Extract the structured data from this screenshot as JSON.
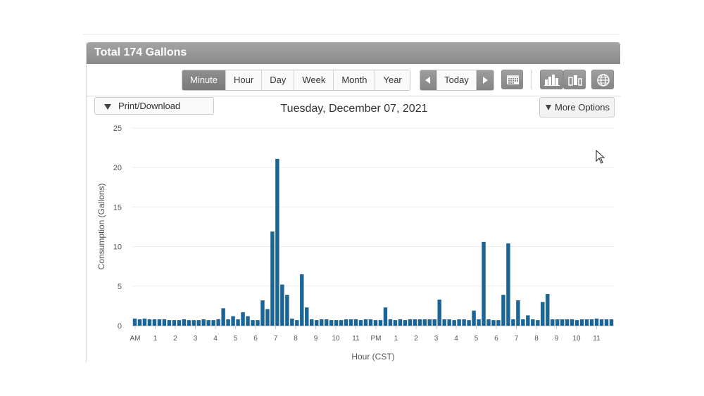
{
  "header": {
    "title": "Total 174 Gallons"
  },
  "toolbar": {
    "intervals": [
      {
        "label": "Minute",
        "active": true
      },
      {
        "label": "Hour",
        "active": false
      },
      {
        "label": "Day",
        "active": false
      },
      {
        "label": "Week",
        "active": false
      },
      {
        "label": "Month",
        "active": false
      },
      {
        "label": "Year",
        "active": false
      }
    ],
    "today_label": "Today",
    "icons": {
      "prev": "chevron-left-icon",
      "next": "chevron-right-icon",
      "calendar": "calendar-icon",
      "bar_chart": "bar-chart-icon",
      "compare_chart": "compare-chart-icon",
      "globe": "globe-icon"
    }
  },
  "print_download": {
    "label": "Print/Download"
  },
  "more_options": {
    "label": "More Options"
  },
  "date_title": "Tuesday, December 07, 2021",
  "colors": {
    "bar": "#1a6496",
    "header": "#969696",
    "active_button": "#848484"
  },
  "chart_data": {
    "type": "bar",
    "ylabel": "Consumption (Gallons)",
    "xlabel": "Hour (CST)",
    "ylim": [
      0,
      25
    ],
    "yticks": [
      0,
      5,
      10,
      15,
      20,
      25
    ],
    "grid": true,
    "x_tick_labels": [
      "AM",
      "1",
      "2",
      "3",
      "4",
      "5",
      "6",
      "7",
      "8",
      "9",
      "10",
      "11",
      "PM",
      "1",
      "2",
      "3",
      "4",
      "5",
      "6",
      "7",
      "8",
      "9",
      "10",
      "11"
    ],
    "values": [
      0.9,
      0.8,
      0.9,
      0.8,
      0.8,
      0.8,
      0.8,
      0.7,
      0.7,
      0.7,
      0.8,
      0.7,
      0.7,
      0.7,
      0.8,
      0.7,
      0.7,
      0.8,
      2.2,
      0.8,
      1.2,
      0.8,
      1.7,
      1.2,
      0.7,
      0.7,
      3.2,
      2.1,
      11.9,
      21.1,
      5.2,
      3.9,
      0.9,
      0.7,
      6.5,
      2.3,
      0.8,
      0.7,
      0.8,
      0.8,
      0.7,
      0.7,
      0.7,
      0.8,
      0.8,
      0.8,
      0.7,
      0.8,
      0.8,
      0.7,
      0.7,
      2.3,
      0.8,
      0.7,
      0.8,
      0.7,
      0.8,
      0.8,
      0.8,
      0.8,
      0.8,
      0.8,
      3.3,
      0.8,
      0.8,
      0.7,
      0.8,
      0.8,
      0.7,
      1.9,
      0.8,
      10.6,
      0.8,
      0.7,
      0.7,
      3.9,
      10.4,
      0.8,
      3.2,
      0.8,
      1.3,
      0.8,
      0.7,
      3.0,
      4.0,
      0.8,
      0.8,
      0.8,
      0.8,
      0.8,
      0.7,
      0.8,
      0.8,
      0.8,
      0.9,
      0.8,
      0.8,
      0.8
    ]
  }
}
